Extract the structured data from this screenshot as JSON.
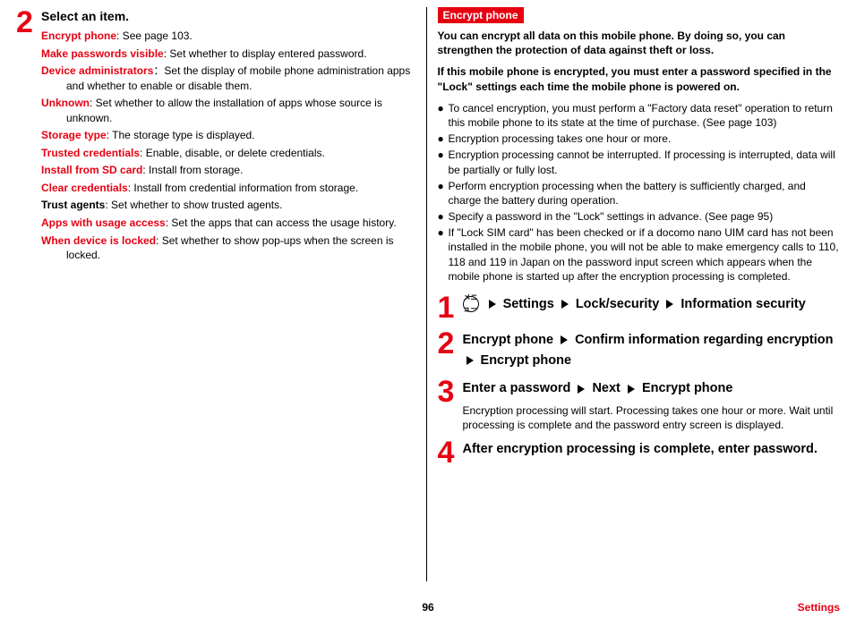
{
  "left": {
    "step_num": "2",
    "step_title": "Select an item.",
    "items": [
      {
        "term": "Encrypt phone",
        "desc": ": See page 103."
      },
      {
        "term": "Make passwords visible",
        "desc": ": Set whether to display entered password."
      },
      {
        "term": "Device administrators",
        "desc": "：Set the display of mobile phone administration apps and whether to enable or disable them."
      },
      {
        "term": "Unknown",
        "desc": ":  Set whether to allow the installation of apps whose source is unknown."
      },
      {
        "term": "Storage type",
        "desc": ": The storage type is displayed."
      },
      {
        "term": "Trusted credentials",
        "desc": ": Enable, disable, or delete credentials."
      },
      {
        "term": "Install from SD card",
        "desc": ": Install from storage."
      },
      {
        "term": "Clear credentials",
        "desc": ": Install from credential information from storage."
      },
      {
        "term": "Trust agents",
        "desc": ": Set whether to show trusted agents.",
        "black": true
      },
      {
        "term": "Apps with usage access",
        "desc": ": Set the apps that can access the usage history."
      },
      {
        "term": "When device is locked",
        "desc": ": Set whether to show pop-ups when the screen is locked."
      }
    ]
  },
  "right": {
    "tag": "Encrypt phone",
    "intro1": "You can encrypt all data on this mobile phone. By doing so, you can strengthen the protection of data against theft or loss.",
    "intro2": "If this mobile phone is encrypted, you must enter a password specified in the \"Lock\" settings each time the mobile phone is powered on.",
    "bullets": [
      "To cancel encryption, you must perform a \"Factory data reset\" operation to return this mobile phone to its state at the time of purchase. (See page 103)",
      "Encryption processing takes one hour or more.",
      "Encryption processing cannot be interrupted. If processing is interrupted, data will be partially or fully lost.",
      "Perform encryption processing when the battery is sufficiently charged, and charge the battery during operation.",
      "Specify a password in the \"Lock\" settings in advance. (See page 95)",
      "If \"Lock SIM card\" has been checked or if a docomo nano UIM card has not been installed in the mobile phone, you will not be able to make emergency calls to 110, 118 and 119 in Japan on the password input screen which appears when the mobile phone is started up after the encryption processing is completed."
    ],
    "steps": {
      "s1": {
        "num": "1",
        "menu_label": "メニュー",
        "w1": "Settings",
        "w2": "Lock/security",
        "w3": "Information security"
      },
      "s2": {
        "num": "2",
        "w1": "Encrypt phone",
        "w2": "Confirm information regarding encryption",
        "w3": "Encrypt phone"
      },
      "s3": {
        "num": "3",
        "w1": "Enter a password",
        "w2": "Next",
        "w3": "Encrypt phone",
        "sub": "Encryption processing will start. Processing takes one hour or more. Wait until processing is complete and the password entry screen is displayed."
      },
      "s4": {
        "num": "4",
        "title": "After encryption processing is complete, enter password."
      }
    }
  },
  "footer": {
    "page": "96",
    "section": "Settings"
  }
}
